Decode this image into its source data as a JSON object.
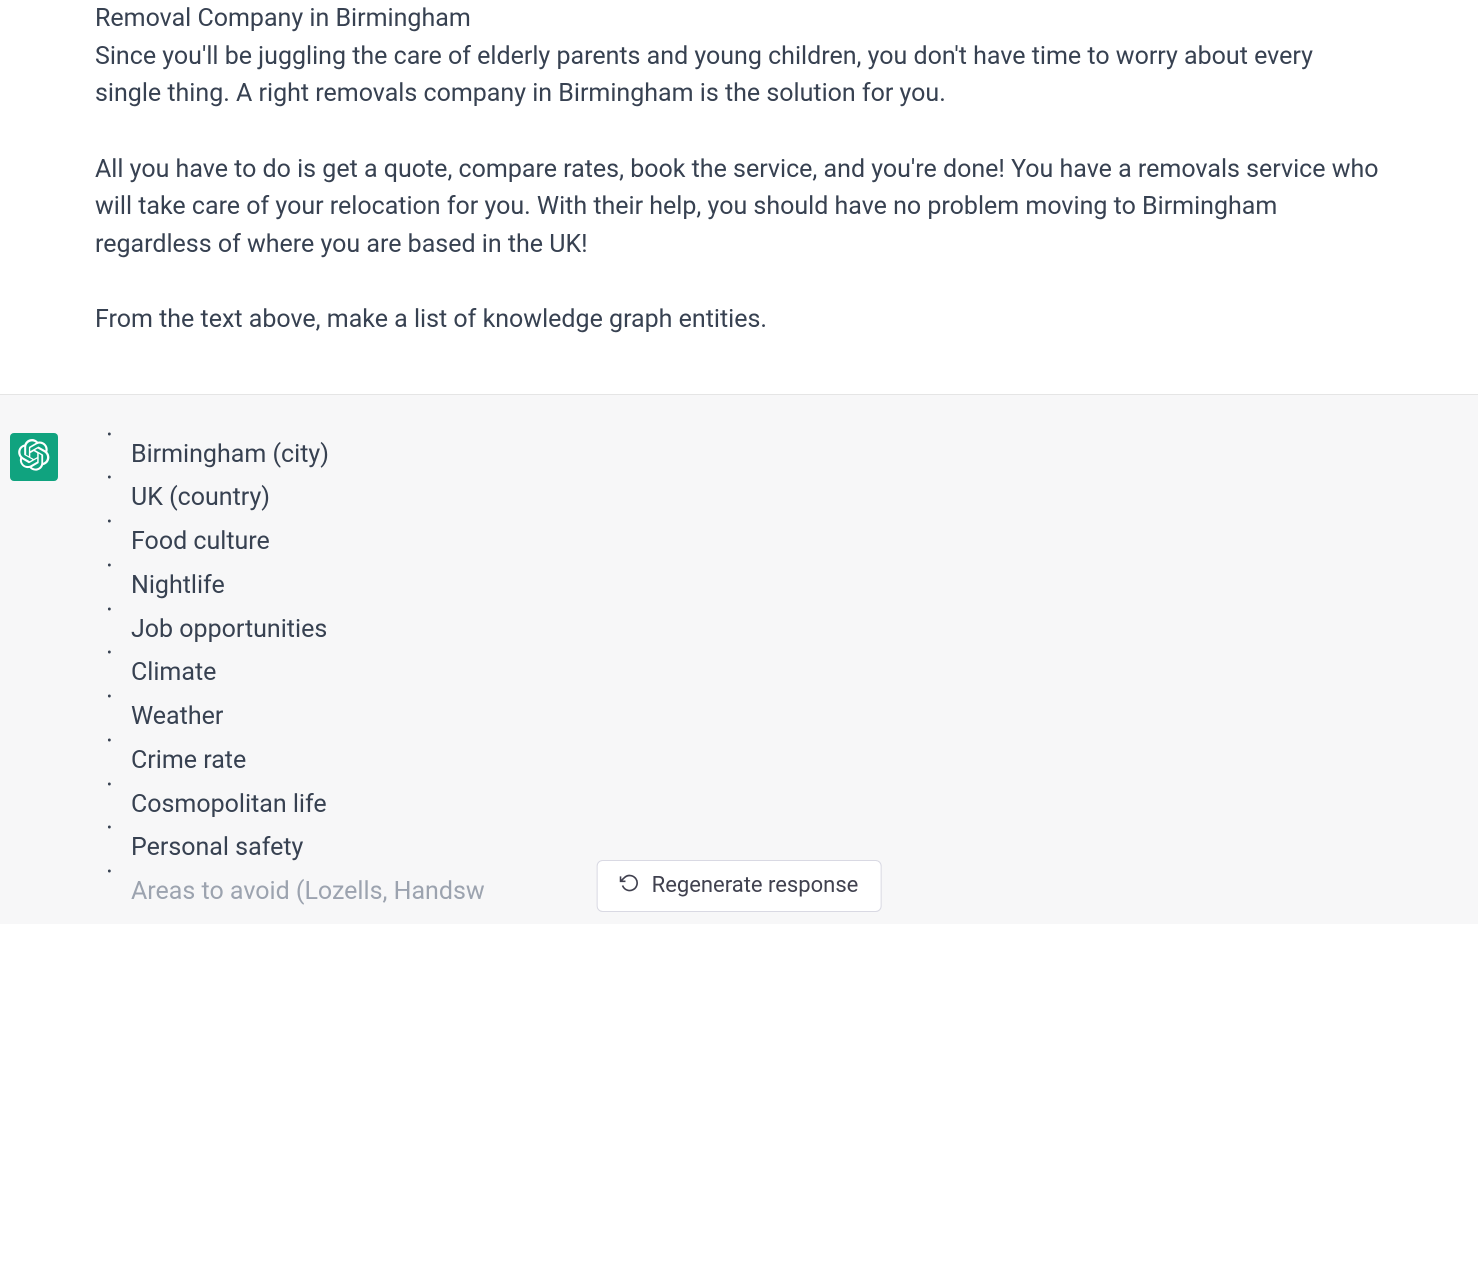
{
  "user_message": {
    "heading": "Removal Company in Birmingham",
    "para1": "Since you'll be juggling the care of elderly parents and young children, you don't have time to worry about every single thing. A right removals company in Birmingham is the solution for you.",
    "para2": "All you have to do is get a quote, compare rates, book the service, and you're done! You have a removals service who will take care of your relocation for you. With their help, you should have no problem moving to Birmingham regardless of where you are based in the UK!",
    "para3": "From the text above, make a list of knowledge graph entities."
  },
  "assistant_message": {
    "items": [
      "Birmingham (city)",
      "UK (country)",
      "Food culture",
      "Nightlife",
      "Job opportunities",
      "Climate",
      "Weather",
      "Crime rate",
      "Cosmopolitan life",
      "Personal safety",
      "Areas to avoid (Lozells, Handsw"
    ]
  },
  "controls": {
    "regenerate_label": "Regenerate response"
  }
}
